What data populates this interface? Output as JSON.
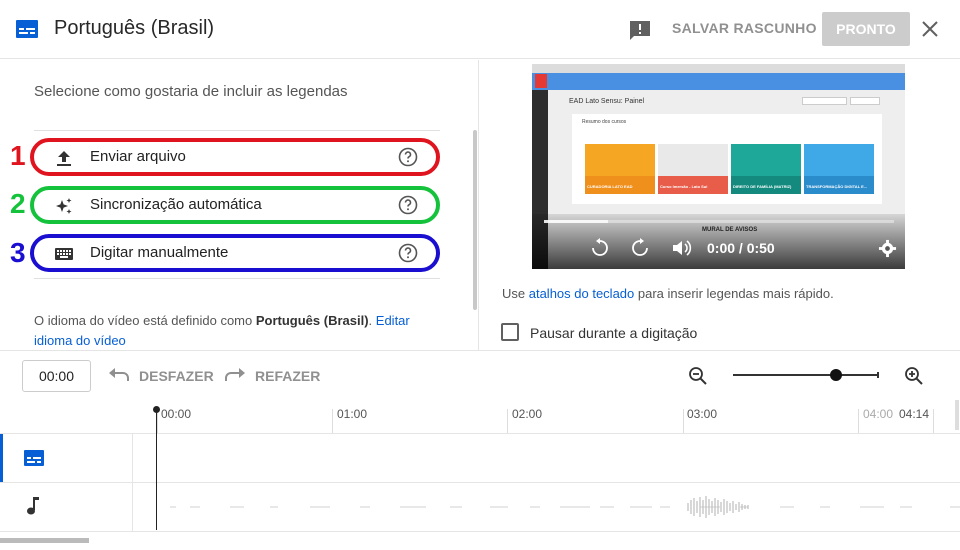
{
  "header": {
    "title": "Português (Brasil)",
    "save_draft": "SALVAR RASCUNHO",
    "done": "PRONTO"
  },
  "options_panel": {
    "instruction": "Selecione como gostaria de incluir as legendas",
    "options": [
      {
        "number": "1",
        "label": "Enviar arquivo",
        "icon": "upload-icon",
        "highlight_color": "#e0141e"
      },
      {
        "number": "2",
        "label": "Sincronização automática",
        "icon": "sparkle-icon",
        "highlight_color": "#15c23c"
      },
      {
        "number": "3",
        "label": "Digitar manualmente",
        "icon": "keyboard-icon",
        "highlight_color": "#1a0fd0"
      }
    ],
    "lang_note": {
      "prefix": "O idioma do vídeo está definido como ",
      "language": "Português (Brasil)",
      "suffix": ". ",
      "link": "Editar idioma do vídeo"
    }
  },
  "video": {
    "time_display": "0:00 / 0:50",
    "page_heading": "EAD Lato Sensu: Painel",
    "section_title": "Resumo dos cursos",
    "course_cards": [
      {
        "label": "CURADORIA LATO EAD",
        "color": "#f5a623",
        "band": "#ef8f1c"
      },
      {
        "label": "Curso Imersão - Lato Sul",
        "color": "#e9e9e9",
        "band": "#e85c4a"
      },
      {
        "label": "DIREITO DE FAMÍLIA (MATRIZ)",
        "color": "#1ea89a",
        "band": "#148a7e"
      },
      {
        "label": "TRANSFORMAÇÃO DIGITAL E...",
        "color": "#3fa9e8",
        "band": "#2b8ccc"
      }
    ],
    "footer_caption": "MURAL DE AVISOS"
  },
  "right_panel": {
    "kb_prefix": "Use ",
    "kb_link": "atalhos do teclado",
    "kb_suffix": " para inserir legendas mais rápido.",
    "pause_label": "Pausar durante a digitação"
  },
  "toolbar": {
    "time_value": "00:00",
    "undo": "DESFAZER",
    "redo": "REFAZER",
    "zoom_level_fraction": 0.71
  },
  "timeline": {
    "ruler": [
      "00:00",
      "01:00",
      "02:00",
      "03:00",
      "04:00",
      "04:14"
    ]
  },
  "colors": {
    "accent_blue": "#065fd4",
    "done_disabled": "#cccccc"
  }
}
